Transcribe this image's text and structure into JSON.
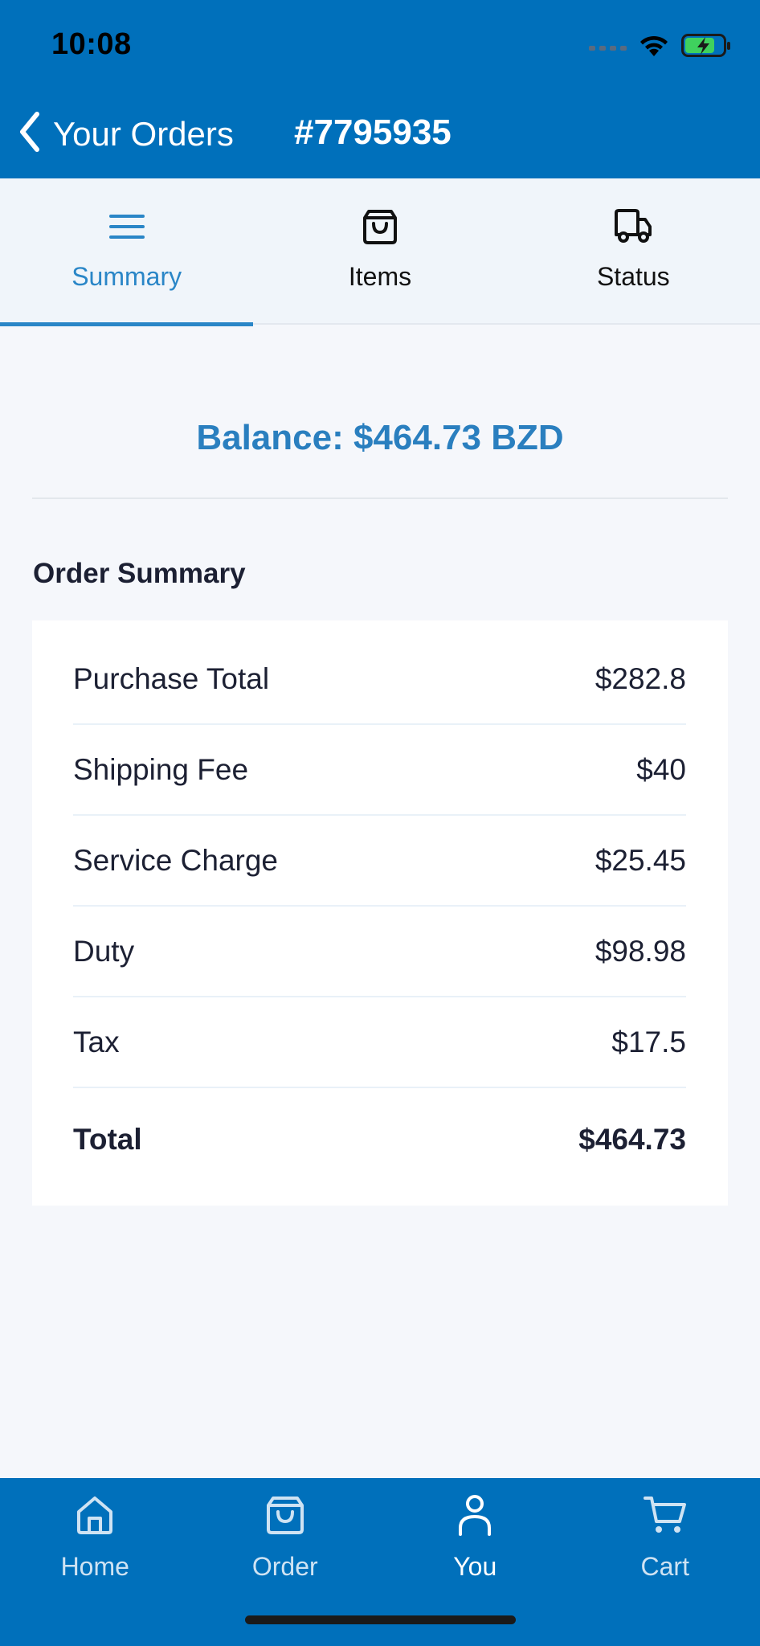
{
  "status_bar": {
    "time": "10:08"
  },
  "header": {
    "back_label": "Your Orders",
    "order_number": "#7795935",
    "background": "#0070bb"
  },
  "tabs": [
    {
      "label": "Summary",
      "icon": "list-icon",
      "active": true
    },
    {
      "label": "Items",
      "icon": "shopping-bag-icon",
      "active": false
    },
    {
      "label": "Status",
      "icon": "truck-icon",
      "active": false
    }
  ],
  "balance": {
    "text": "Balance: $464.73 BZD",
    "color": "#2a7fbf"
  },
  "order_summary": {
    "title": "Order Summary",
    "rows": [
      {
        "label": "Purchase Total",
        "value": "$282.8"
      },
      {
        "label": "Shipping Fee",
        "value": "$40"
      },
      {
        "label": "Service Charge",
        "value": "$25.45"
      },
      {
        "label": "Duty",
        "value": "$98.98"
      },
      {
        "label": "Tax",
        "value": "$17.5"
      }
    ],
    "total": {
      "label": "Total",
      "value": "$464.73"
    }
  },
  "bottom_nav": [
    {
      "label": "Home",
      "icon": "home-icon",
      "active": false
    },
    {
      "label": "Order",
      "icon": "shopping-bag-icon",
      "active": false
    },
    {
      "label": "You",
      "icon": "user-icon",
      "active": true
    },
    {
      "label": "Cart",
      "icon": "cart-icon",
      "active": false
    }
  ]
}
